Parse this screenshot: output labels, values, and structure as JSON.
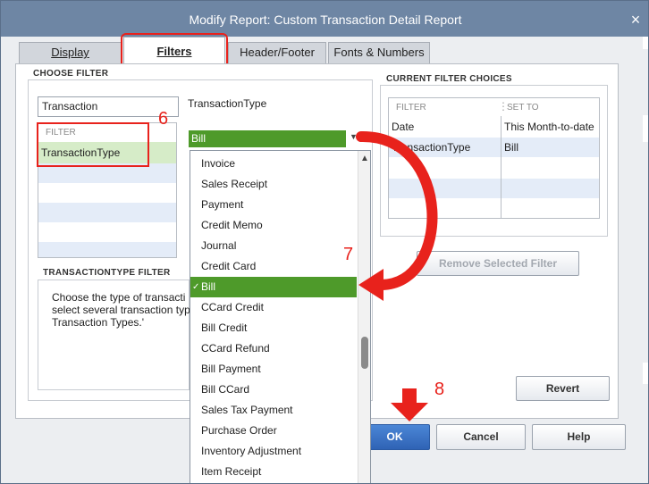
{
  "window": {
    "title": "Modify Report: Custom Transaction Detail Report",
    "close_glyph": "×"
  },
  "tabs": [
    {
      "label": "Display",
      "active": false
    },
    {
      "label": "Filters",
      "active": true
    },
    {
      "label": "Header/Footer",
      "active": false
    },
    {
      "label": "Fonts & Numbers",
      "active": false
    }
  ],
  "choose_filter": {
    "heading": "CHOOSE FILTER",
    "search_value": "Transaction",
    "filter_header": "FILTER",
    "filter_items": [
      "TransactionType"
    ],
    "selected_filter_title": "TransactionType",
    "combo_value": "Bill"
  },
  "description": {
    "heading": "TRANSACTIONTYPE FILTER",
    "lines": [
      "Choose the type of transacti",
      "select several transaction typ",
      "Transaction Types.'"
    ]
  },
  "dropdown": {
    "items": [
      "Invoice",
      "Sales Receipt",
      "Payment",
      "Credit Memo",
      "Journal",
      "Credit Card",
      "Bill",
      "CCard Credit",
      "Bill Credit",
      "CCard Refund",
      "Bill Payment",
      "Bill CCard",
      "Sales Tax Payment",
      "Purchase Order",
      "Inventory Adjustment",
      "Item Receipt"
    ],
    "selected": "Bill",
    "check_glyph": "✓"
  },
  "current_filters": {
    "heading": "CURRENT FILTER CHOICES",
    "col_filter": "FILTER",
    "col_set_to": "SET TO",
    "rows": [
      {
        "filter": "Date",
        "set_to": "This Month-to-date"
      },
      {
        "filter": "TransactionType",
        "set_to": "Bill"
      }
    ]
  },
  "buttons": {
    "remove": "Remove Selected Filter",
    "revert": "Revert",
    "ok": "OK",
    "cancel": "Cancel",
    "help": "Help"
  },
  "annotations": [
    "6",
    "7",
    "8"
  ],
  "colors": {
    "title_bar": "#6e86a4",
    "selection_green": "#4e9a2a",
    "annotation_red": "#e8221c",
    "ok_blue": "#2f63b5"
  }
}
